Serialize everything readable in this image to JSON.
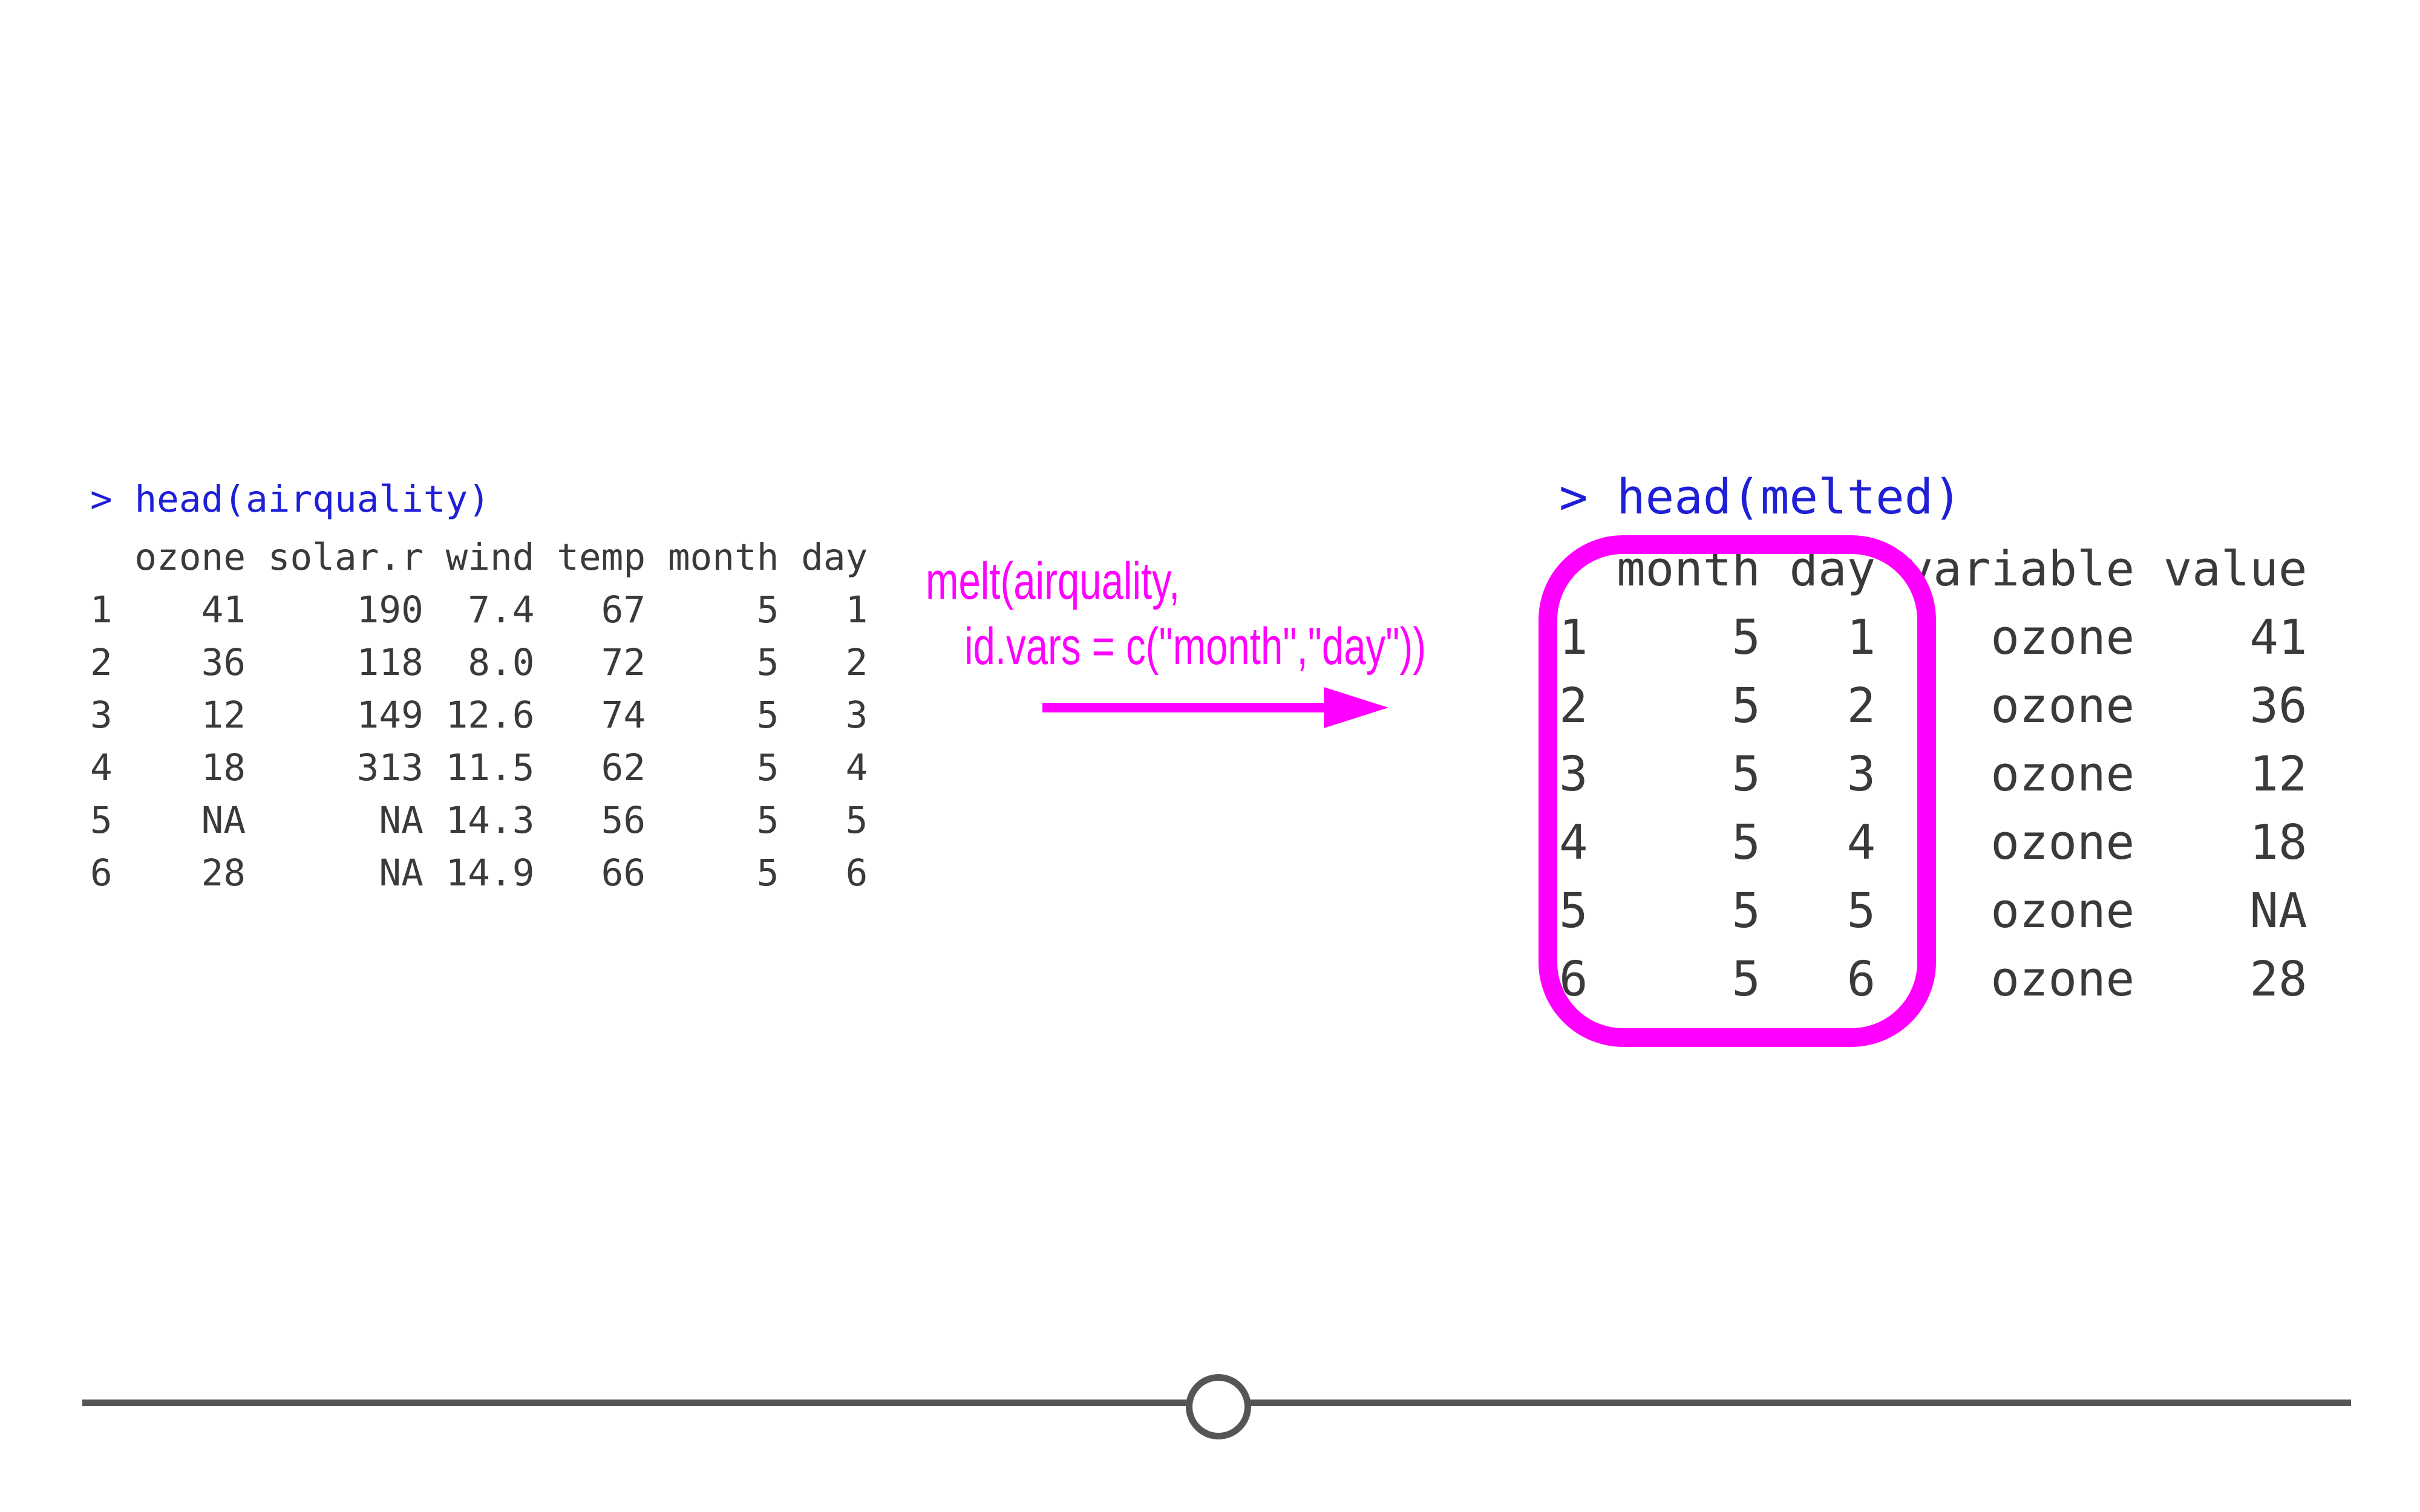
{
  "left": {
    "prompt": "> head(airquality)",
    "headers": [
      "",
      "ozone",
      "solar.r",
      "wind",
      "temp",
      "month",
      "day"
    ],
    "rows": [
      [
        "1",
        "41",
        "190",
        "7.4",
        "67",
        "5",
        "1"
      ],
      [
        "2",
        "36",
        "118",
        "8.0",
        "72",
        "5",
        "2"
      ],
      [
        "3",
        "12",
        "149",
        "12.6",
        "74",
        "5",
        "3"
      ],
      [
        "4",
        "18",
        "313",
        "11.5",
        "62",
        "5",
        "4"
      ],
      [
        "5",
        "NA",
        "NA",
        "14.3",
        "56",
        "5",
        "5"
      ],
      [
        "6",
        "28",
        "NA",
        "14.9",
        "66",
        "5",
        "6"
      ]
    ]
  },
  "callout": {
    "line1": "melt(airquality,",
    "line2": "id.vars = c(\"month\",\"day\"))"
  },
  "right": {
    "prompt": "> head(melted)",
    "headers": [
      "",
      "month",
      "day",
      "variable",
      "value"
    ],
    "rows": [
      [
        "1",
        "5",
        "1",
        "ozone",
        "41"
      ],
      [
        "2",
        "5",
        "2",
        "ozone",
        "36"
      ],
      [
        "3",
        "5",
        "3",
        "ozone",
        "12"
      ],
      [
        "4",
        "5",
        "4",
        "ozone",
        "18"
      ],
      [
        "5",
        "5",
        "5",
        "ozone",
        "NA"
      ],
      [
        "6",
        "5",
        "6",
        "ozone",
        "28"
      ]
    ]
  },
  "slider": {
    "position": 0.49
  },
  "colors": {
    "accent": "#ff00ff",
    "prompt": "#1f1fd6",
    "text": "#3a3a3a",
    "slider": "#555555"
  }
}
